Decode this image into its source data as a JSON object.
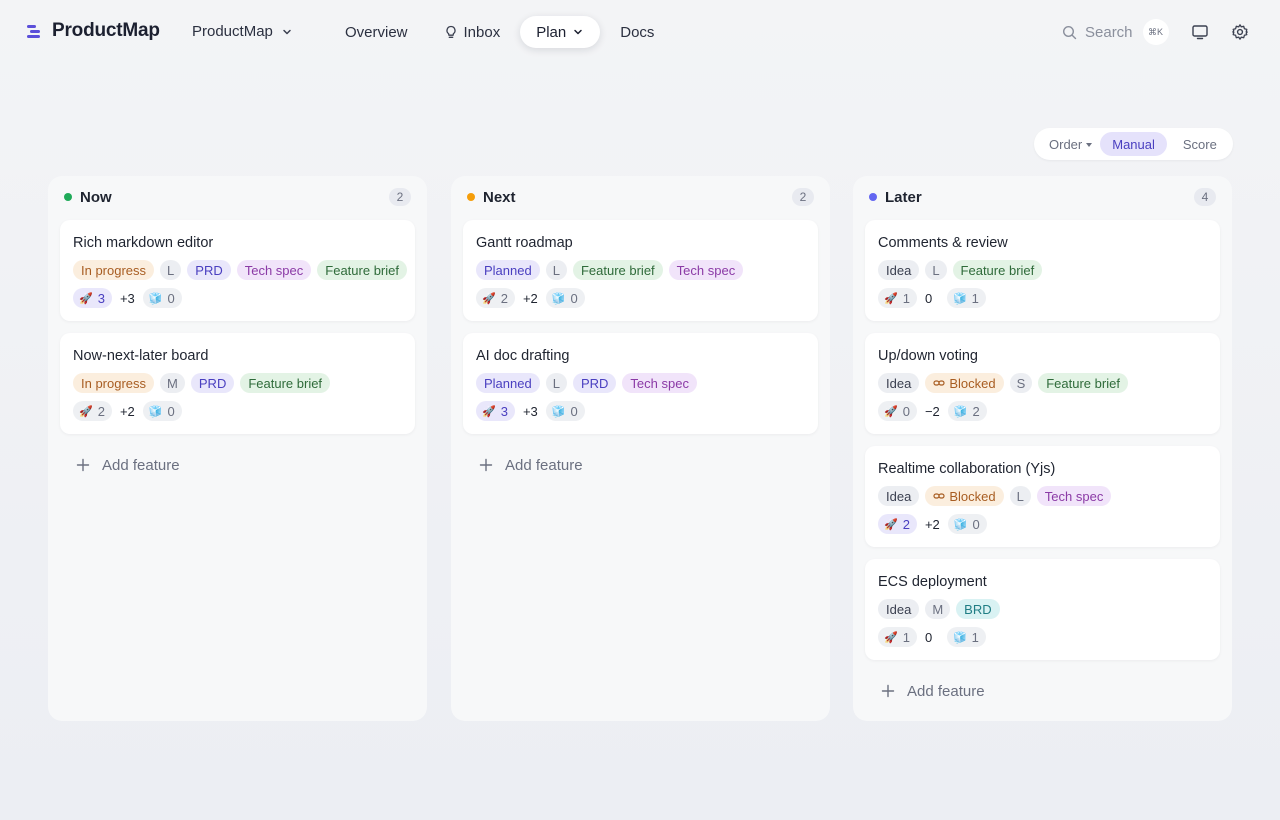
{
  "app": {
    "name": "ProductMap",
    "workspace": "ProductMap"
  },
  "nav": {
    "overview": "Overview",
    "inbox": "Inbox",
    "plan": "Plan",
    "docs": "Docs"
  },
  "search": {
    "label": "Search",
    "shortcut": "⌘K"
  },
  "order": {
    "label": "Order",
    "manual": "Manual",
    "score": "Score",
    "selected": "Manual"
  },
  "add_feature_label": "Add feature",
  "colors": {
    "accent": "#5b4fd9",
    "now": "#1faa59",
    "next": "#f59e0b",
    "later": "#6366f1"
  },
  "columns": [
    {
      "title": "Now",
      "count": "2",
      "cards": [
        {
          "title": "Rich markdown editor",
          "status": "In progress",
          "size": "L",
          "docs": [
            "PRD",
            "Tech spec",
            "Feature brief"
          ],
          "rockets": "3",
          "score": "+3",
          "cubes": "0"
        },
        {
          "title": "Now-next-later board",
          "status": "In progress",
          "size": "M",
          "docs": [
            "PRD",
            "Feature brief"
          ],
          "rockets": "2",
          "score": "+2",
          "cubes": "0"
        }
      ]
    },
    {
      "title": "Next",
      "count": "2",
      "cards": [
        {
          "title": "Gantt roadmap",
          "status": "Planned",
          "size": "L",
          "docs": [
            "Feature brief",
            "Tech spec"
          ],
          "rockets": "2",
          "score": "+2",
          "cubes": "0"
        },
        {
          "title": "AI doc drafting",
          "status": "Planned",
          "size": "L",
          "docs": [
            "PRD",
            "Tech spec"
          ],
          "rockets": "3",
          "score": "+3",
          "cubes": "0"
        }
      ]
    },
    {
      "title": "Later",
      "count": "4",
      "cards": [
        {
          "title": "Comments & review",
          "status": "Idea",
          "size": "L",
          "docs": [
            "Feature brief"
          ],
          "rockets": "1",
          "score": "0",
          "cubes": "1"
        },
        {
          "title": "Up/down voting",
          "status": "Idea",
          "blocked": "Blocked",
          "size": "S",
          "docs": [
            "Feature brief"
          ],
          "rockets": "0",
          "score": "−2",
          "cubes": "2"
        },
        {
          "title": "Realtime collaboration (Yjs)",
          "status": "Idea",
          "blocked": "Blocked",
          "size": "L",
          "docs": [
            "Tech spec"
          ],
          "rockets": "2",
          "score": "+2",
          "cubes": "0"
        },
        {
          "title": "ECS deployment",
          "status": "Idea",
          "size": "M",
          "docs": [
            "BRD"
          ],
          "rockets": "1",
          "score": "0",
          "cubes": "1"
        }
      ]
    }
  ]
}
